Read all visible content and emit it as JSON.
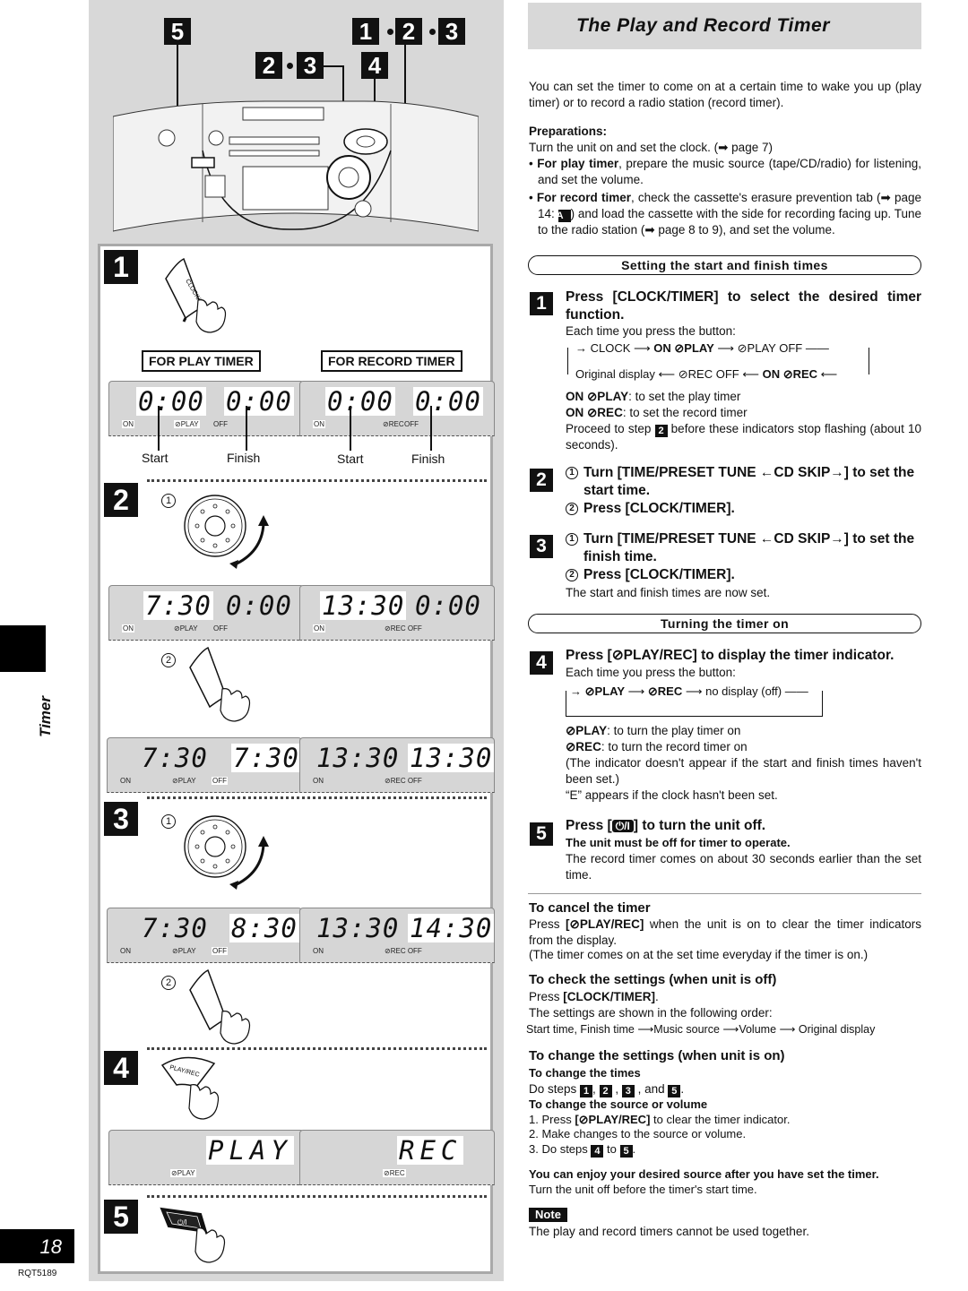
{
  "page": {
    "title": "The Play and Record Timer",
    "section_tab": "Timer",
    "page_number": "18",
    "doc_code": "RQT5189"
  },
  "illustration": {
    "callouts": {
      "power": "5",
      "dial_a": "2",
      "dial_b": "3",
      "play_rec": "4",
      "clock_a": "1",
      "clock_b": "2",
      "clock_c": "3"
    },
    "steps": [
      {
        "num": "1",
        "button": "CLOCK/TIMER",
        "labels": {
          "play": "FOR PLAY TIMER",
          "record": "FOR RECORD TIMER"
        },
        "displays": [
          {
            "start": "0:00",
            "finish": "0:00",
            "on": "ON",
            "mode": "⊘PLAY",
            "off": "OFF"
          },
          {
            "start": "0:00",
            "finish": "0:00",
            "on": "ON",
            "mode": "⊘REC",
            "off": "OFF"
          }
        ],
        "captions": {
          "start": "Start",
          "finish": "Finish"
        }
      },
      {
        "num": "2",
        "sub1": "1",
        "dial_label": "TIME/PRESET TUNE — CD SKIP",
        "displays_a": [
          {
            "start": "7:30",
            "finish": "0:00",
            "on": "ON",
            "mode": "⊘PLAY",
            "off": "OFF"
          },
          {
            "start": "13:30",
            "finish": "0:00",
            "on": "ON",
            "mode": "⊘REC OFF",
            "off": ""
          }
        ],
        "sub2": "2",
        "button": "CLOCK/TIMER",
        "displays_b": [
          {
            "start": "7:30",
            "finish": "7:30",
            "on": "ON",
            "mode": "⊘PLAY",
            "off": "OFF"
          },
          {
            "start": "13:30",
            "finish": "13:30",
            "on": "ON",
            "mode": "⊘REC OFF",
            "off": ""
          }
        ]
      },
      {
        "num": "3",
        "sub1": "1",
        "displays": [
          {
            "start": "7:30",
            "finish": "8:30",
            "on": "ON",
            "mode": "⊘PLAY",
            "off": "OFF"
          },
          {
            "start": "13:30",
            "finish": "14:30",
            "on": "ON",
            "mode": "⊘REC OFF",
            "off": ""
          }
        ],
        "sub2": "2",
        "button": "CLOCK/TIMER"
      },
      {
        "num": "4",
        "button": "⊘PLAY/REC",
        "displays": [
          {
            "text": "PLAY",
            "mode": "⊘PLAY"
          },
          {
            "text": "REC",
            "mode": "⊘REC"
          }
        ]
      },
      {
        "num": "5",
        "button": "⏻/I"
      }
    ]
  },
  "intro": "You can set the timer to come on at a certain time to wake you up (play timer) or to record a radio station (record timer).",
  "preparations": {
    "heading": "Preparations:",
    "line": "Turn the unit on and set the clock. (➡ page 7)",
    "bullets": [
      {
        "bold": "For play timer",
        "text": ", prepare the music source (tape/CD/radio) for listening, and set the volume."
      },
      {
        "bold": "For record timer",
        "text_a": ", check the cassette's erasure prevention tab (➡ page 14: ",
        "badge": "A",
        "text_b": ") and load the cassette with the side for recording facing up. Tune to the radio station (➡ page 8 to 9), and set the volume."
      }
    ]
  },
  "section_setting": "Setting the start and finish times",
  "step1": {
    "num": "1",
    "heading": "Press [CLOCK/TIMER] to select the desired timer function.",
    "each_time": "Each time you press the button:",
    "cycle_top": [
      "CLOCK",
      "ON ⊘PLAY",
      "⊘PLAY OFF"
    ],
    "cycle_bottom": [
      "Original display",
      "⊘REC OFF",
      "ON ⊘REC"
    ],
    "defs": [
      {
        "term": "ON ⊘PLAY",
        "desc": ": to set the play timer"
      },
      {
        "term": "ON ⊘REC",
        "desc": ": to set the record timer"
      }
    ],
    "proceed_a": "Proceed to step",
    "proceed_badge": "2",
    "proceed_b": "before these indicators stop flashing (about 10 seconds)."
  },
  "step2": {
    "num": "2",
    "line1": "Turn [TIME/PRESET TUNE ←CD SKIP→] to set the start time.",
    "line2": "Press [CLOCK/TIMER].",
    "c1": "1",
    "c2": "2"
  },
  "step3": {
    "num": "3",
    "line1": "Turn [TIME/PRESET TUNE ←CD SKIP→] to set the finish time.",
    "line2": "Press [CLOCK/TIMER].",
    "c1": "1",
    "c2": "2",
    "note": "The start and finish times are now set."
  },
  "section_turning_on": "Turning the timer on",
  "step4": {
    "num": "4",
    "heading": "Press [⊘PLAY/REC] to display the timer indicator.",
    "each_time": "Each time you press the button:",
    "cycle": [
      "⊘PLAY",
      "⊘REC",
      "no display (off)"
    ],
    "defs": [
      {
        "term": "⊘PLAY",
        "desc": ": to turn the play timer on"
      },
      {
        "term": "⊘REC",
        "desc": ": to turn the record timer on"
      }
    ],
    "note1": "(The indicator doesn't appear if the start and finish times haven't been set.)",
    "note2": "“E” appears if the clock hasn't been set."
  },
  "step5": {
    "num": "5",
    "heading_a": "Press [",
    "power_glyph": "⏻/I",
    "heading_b": "] to turn the unit off.",
    "bold_line": "The unit must be off for timer to operate.",
    "text": "The record timer comes on about 30 seconds earlier than the set time."
  },
  "cancel": {
    "heading": "To cancel the timer",
    "line_a": "Press ",
    "line_bold": "[⊘PLAY/REC]",
    "line_b": " when the unit is on to clear the timer indicators from the display.",
    "note": "(The timer comes on at the set time everyday if the timer is on.)"
  },
  "check": {
    "heading": "To check the settings (when unit is off)",
    "press_a": "Press ",
    "press_bold": "[CLOCK/TIMER]",
    "press_b": ".",
    "order_intro": "The settings are shown in the following order:",
    "order": [
      "Start time, Finish time",
      "Music source",
      "Volume",
      "Original display"
    ]
  },
  "change": {
    "heading": "To change the settings (when unit is on)",
    "times_heading": "To change the times",
    "times_text_a": "Do steps",
    "times_badges": [
      "1",
      "2",
      "3",
      "5"
    ],
    "source_heading": "To change the source or volume",
    "items": [
      {
        "n": "1.",
        "a": "Press ",
        "bold": "[⊘PLAY/REC]",
        "b": " to clear the timer indicator."
      },
      {
        "n": "2.",
        "a": "Make changes to the source or volume.",
        "bold": "",
        "b": ""
      },
      {
        "n": "3.",
        "a": "Do steps",
        "badge1": "4",
        "to": "to",
        "badge2": "5"
      }
    ]
  },
  "enjoy": {
    "bold": "You can enjoy your desired source after you have set the timer.",
    "text": "Turn the unit off before the timer's start time."
  },
  "note": {
    "label": "Note",
    "text": "The play and record timers cannot be used together."
  }
}
